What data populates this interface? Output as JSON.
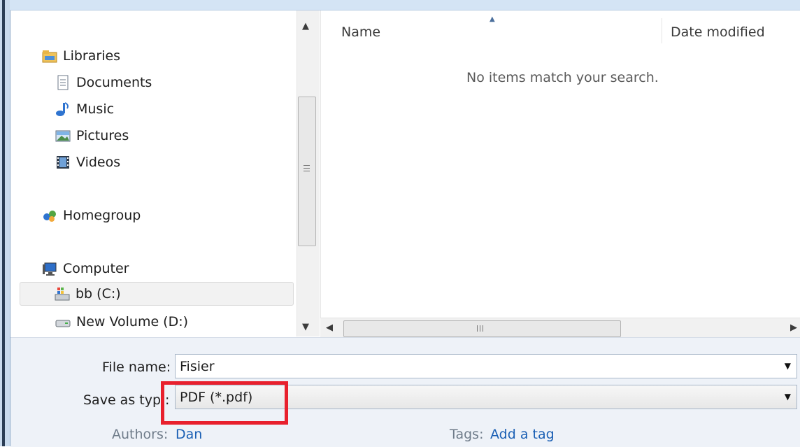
{
  "nav": {
    "libraries": "Libraries",
    "documents": "Documents",
    "music": "Music",
    "pictures": "Pictures",
    "videos": "Videos",
    "homegroup": "Homegroup",
    "computer": "Computer",
    "drive_c": "bb (C:)",
    "drive_d": "New Volume (D:)"
  },
  "list": {
    "col_name": "Name",
    "col_date": "Date modified",
    "empty_message": "No items match your search."
  },
  "form": {
    "file_name_label": "File name:",
    "file_name_value": "Fisier",
    "save_type_label": "Save as typ",
    "save_type_label_tail": ":",
    "save_type_value": "PDF (*.pdf)",
    "authors_label": "Authors:",
    "authors_value": "Dan",
    "tags_label": "Tags:",
    "tags_value": "Add a tag"
  },
  "colors": {
    "highlight": "#e8202d",
    "link": "#1a5fb4"
  }
}
